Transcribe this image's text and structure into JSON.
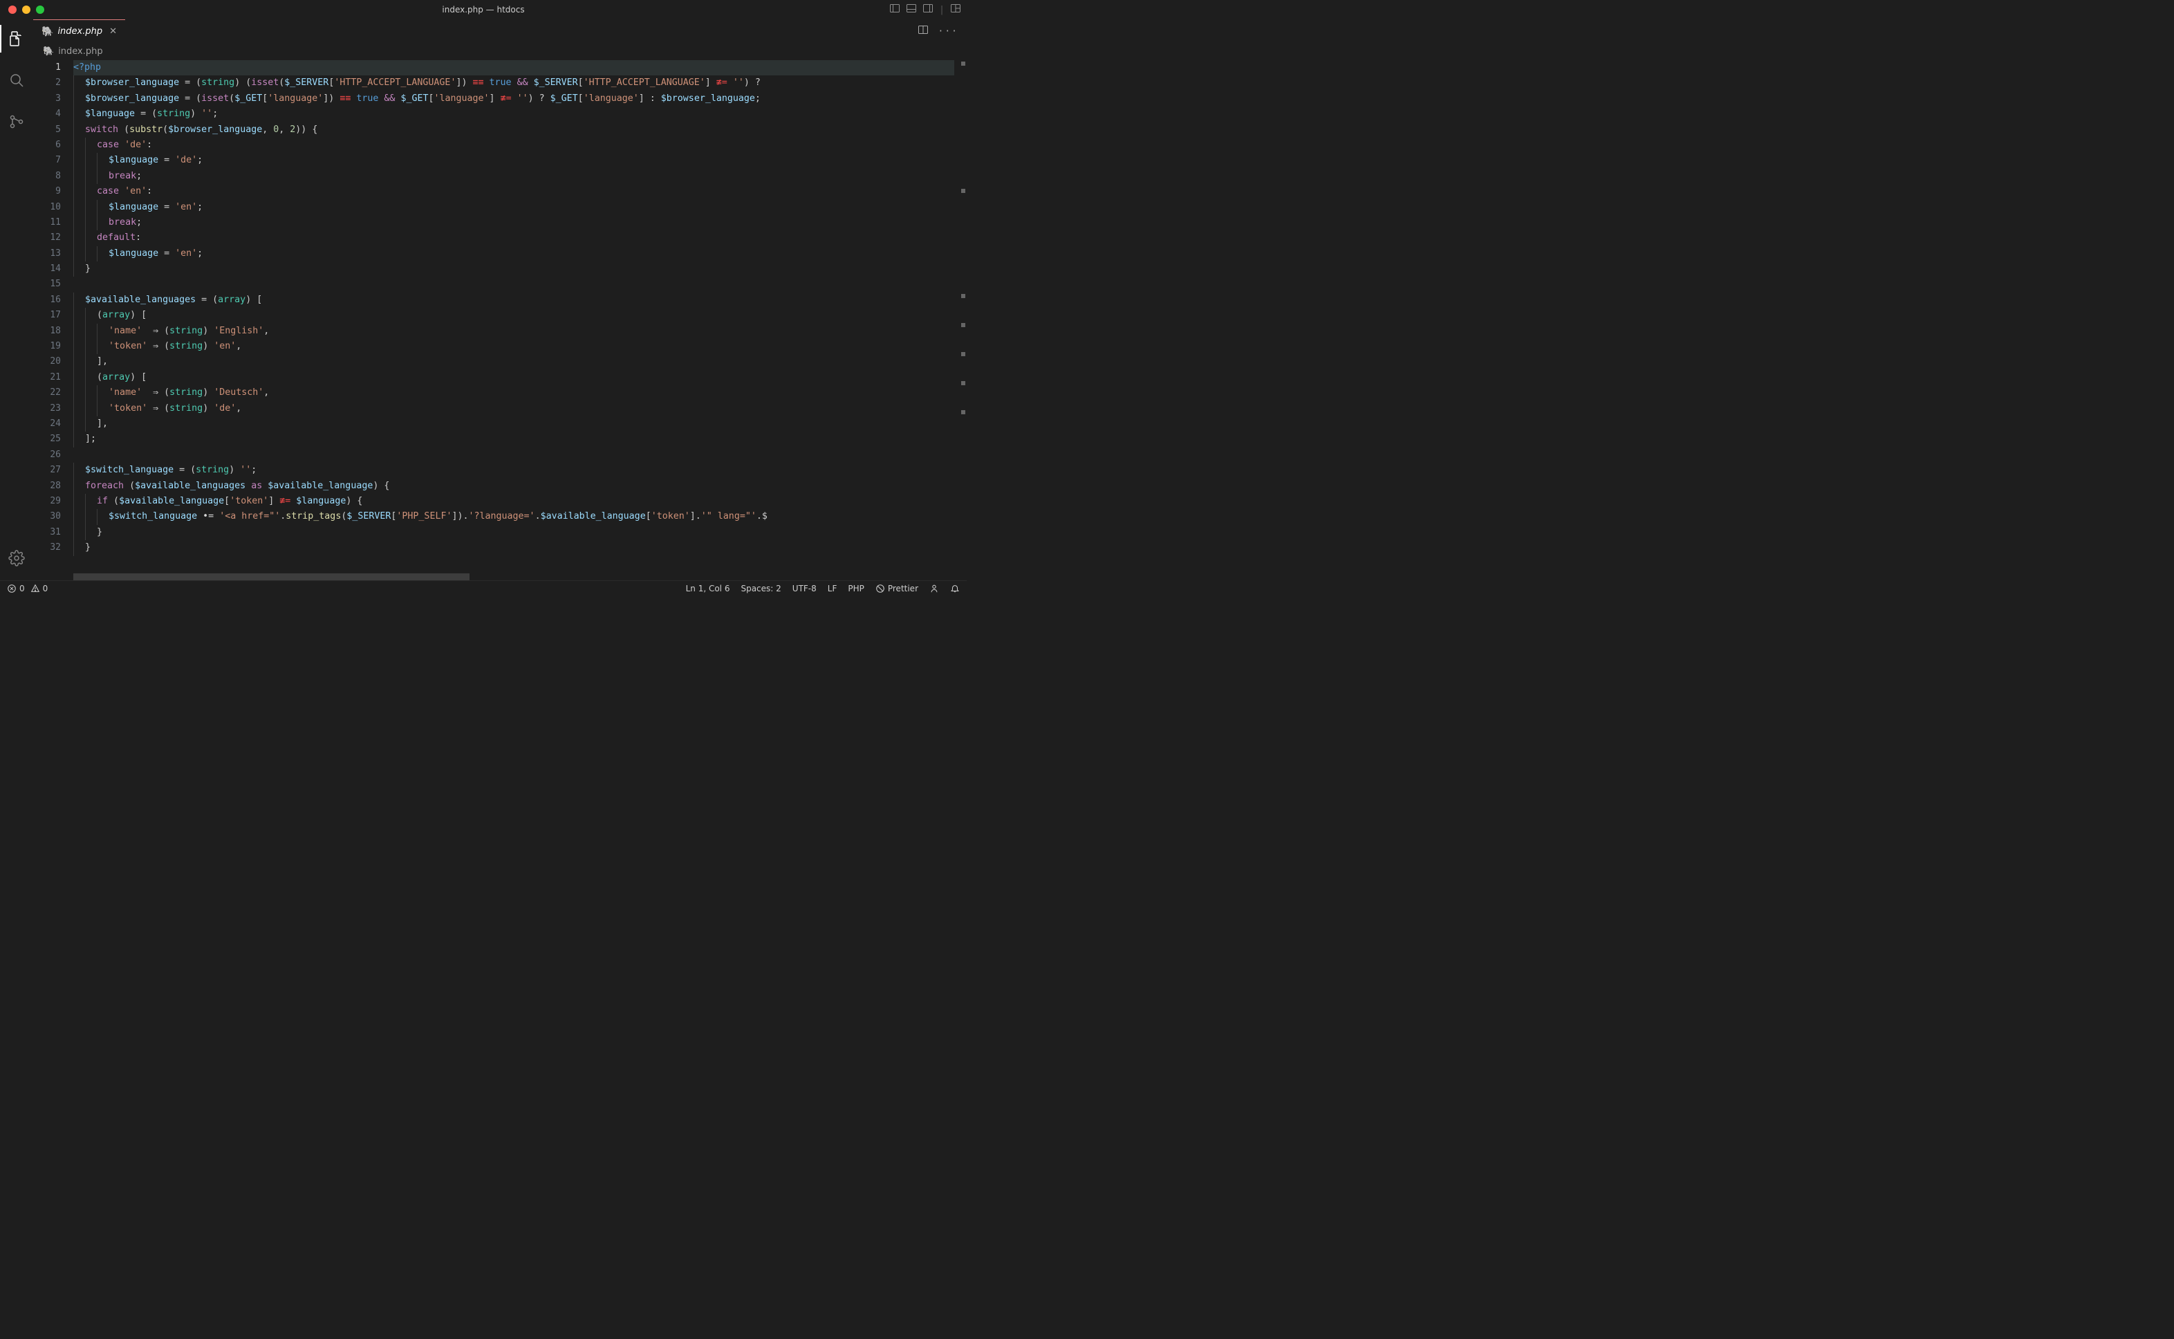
{
  "window": {
    "title": "index.php — htdocs"
  },
  "tab": {
    "label": "index.php",
    "icon": "🐘"
  },
  "breadcrumb": {
    "icon": "🐘",
    "text": "index.php"
  },
  "gutter": {
    "lines": [
      "1",
      "2",
      "3",
      "4",
      "5",
      "6",
      "7",
      "8",
      "9",
      "10",
      "11",
      "12",
      "13",
      "14",
      "15",
      "16",
      "17",
      "18",
      "19",
      "20",
      "21",
      "22",
      "23",
      "24",
      "25",
      "26",
      "27",
      "28",
      "29",
      "30",
      "31",
      "32"
    ],
    "active_line": 1
  },
  "code_raw": {
    "1": "<?php",
    "2": "  $browser_language = (string) (isset($_SERVER['HTTP_ACCEPT_LANGUAGE']) === true && $_SERVER['HTTP_ACCEPT_LANGUAGE'] !== '') ?",
    "3": "  $browser_language = (isset($_GET['language']) === true && $_GET['language'] !== '') ? $_GET['language'] : $browser_language;",
    "4": "  $language = (string) '';",
    "5": "  switch (substr($browser_language, 0, 2)) {",
    "6": "    case 'de':",
    "7": "      $language = 'de';",
    "8": "      break;",
    "9": "    case 'en':",
    "10": "      $language = 'en';",
    "11": "      break;",
    "12": "    default:",
    "13": "      $language = 'en';",
    "14": "  }",
    "15": "",
    "16": "  $available_languages = (array) [",
    "17": "    (array) [",
    "18": "      'name'  => (string) 'English',",
    "19": "      'token' => (string) 'en',",
    "20": "    ],",
    "21": "    (array) [",
    "22": "      'name'  => (string) 'Deutsch',",
    "23": "      'token' => (string) 'de',",
    "24": "    ],",
    "25": "  ];",
    "26": "",
    "27": "  $switch_language = (string) '';",
    "28": "  foreach ($available_languages as $available_language) {",
    "29": "    if ($available_language['token'] !== $language) {",
    "30": "      $switch_language .= '<a href=\"'.strip_tags($_SERVER['PHP_SELF']).'?language='.$available_language['token'].'\" lang=\"'.$",
    "31": "    }",
    "32": "  }"
  },
  "statusbar": {
    "errors": "0",
    "warnings": "0",
    "position": "Ln 1, Col 6",
    "spaces": "Spaces: 2",
    "encoding": "UTF-8",
    "eol": "LF",
    "language": "PHP",
    "prettier": "Prettier"
  }
}
